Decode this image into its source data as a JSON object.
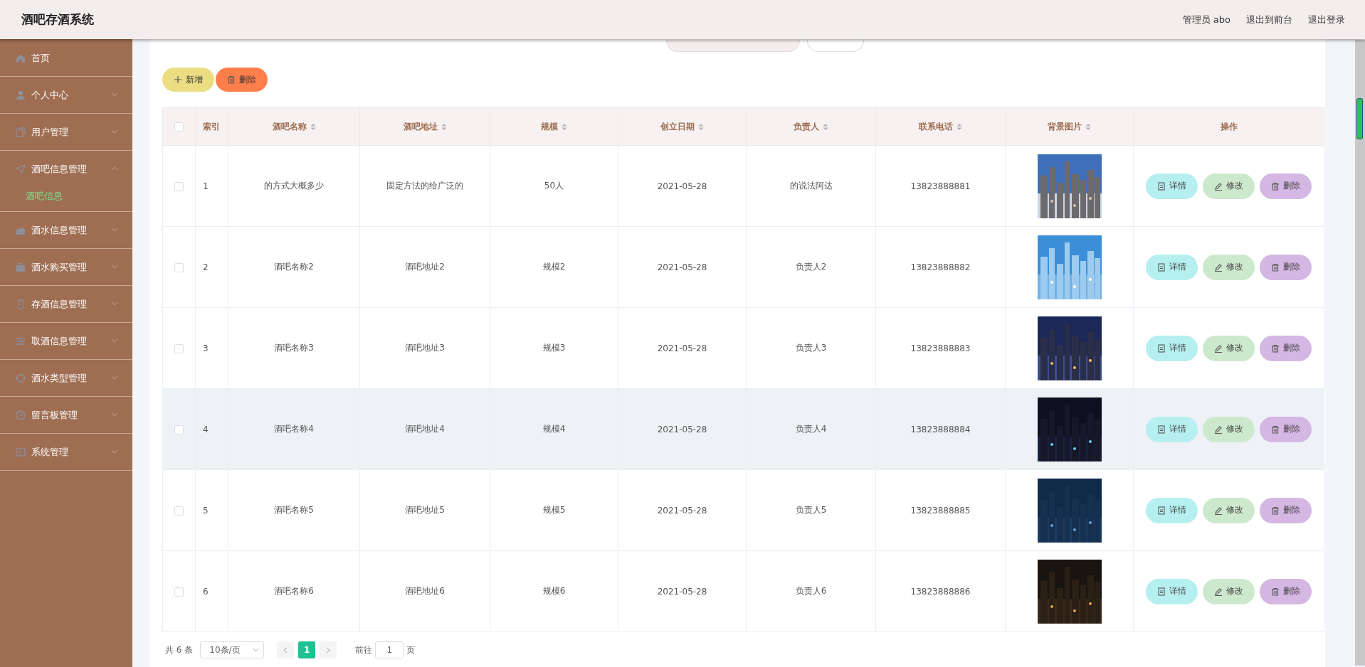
{
  "header": {
    "title": "酒吧存酒系统",
    "user": "管理员 abo",
    "links": [
      "退出到前台",
      "退出登录"
    ]
  },
  "sidebar": {
    "items": [
      {
        "label": "首页",
        "kind": "link"
      },
      {
        "label": "个人中心",
        "kind": "menu",
        "expanded": false
      },
      {
        "label": "用户管理",
        "kind": "menu",
        "expanded": false
      },
      {
        "label": "酒吧信息管理",
        "kind": "menu",
        "expanded": true,
        "children": [
          {
            "label": "酒吧信息",
            "selected": true
          }
        ]
      },
      {
        "label": "酒水信息管理",
        "kind": "menu",
        "expanded": false
      },
      {
        "label": "酒水购买管理",
        "kind": "menu",
        "expanded": false
      },
      {
        "label": "存酒信息管理",
        "kind": "menu",
        "expanded": false
      },
      {
        "label": "取酒信息管理",
        "kind": "menu",
        "expanded": false
      },
      {
        "label": "酒水类型管理",
        "kind": "menu",
        "expanded": false
      },
      {
        "label": "留言板管理",
        "kind": "menu",
        "expanded": false
      },
      {
        "label": "系统管理",
        "kind": "menu",
        "expanded": false
      }
    ]
  },
  "actions": [
    {
      "label": "新增",
      "kind": "add"
    },
    {
      "label": "删除",
      "kind": "delete"
    }
  ],
  "table": {
    "select_all": {
      "checked": false
    },
    "columns": [
      {
        "label": "索引",
        "sortable": false
      },
      {
        "label": "酒吧名称",
        "sortable": true
      },
      {
        "label": "酒吧地址",
        "sortable": true
      },
      {
        "label": "规模",
        "sortable": true
      },
      {
        "label": "创立日期",
        "sortable": true
      },
      {
        "label": "负责人",
        "sortable": true
      },
      {
        "label": "联系电话",
        "sortable": true
      },
      {
        "label": "背景图片",
        "sortable": true
      },
      {
        "label": "操作",
        "sortable": false
      }
    ],
    "rows": [
      {
        "checked": false,
        "highlighted": false,
        "cells": [
          "1",
          "的方式大概多少",
          "固定方法的给广泛的",
          "50人",
          "2021-05-28",
          "的说法阿达",
          "13823888881"
        ],
        "actions": [
          {
            "label": "详情",
            "kind": "detail"
          },
          {
            "label": "修改",
            "kind": "edit"
          },
          {
            "label": "删除",
            "kind": "delete"
          }
        ]
      },
      {
        "checked": false,
        "highlighted": false,
        "cells": [
          "2",
          "酒吧名称2",
          "酒吧地址2",
          "规模2",
          "2021-05-28",
          "负责人2",
          "13823888882"
        ],
        "actions": [
          {
            "label": "详情",
            "kind": "detail"
          },
          {
            "label": "修改",
            "kind": "edit"
          },
          {
            "label": "删除",
            "kind": "delete"
          }
        ]
      },
      {
        "checked": false,
        "highlighted": false,
        "cells": [
          "3",
          "酒吧名称3",
          "酒吧地址3",
          "规模3",
          "2021-05-28",
          "负责人3",
          "13823888883"
        ],
        "actions": [
          {
            "label": "详情",
            "kind": "detail"
          },
          {
            "label": "修改",
            "kind": "edit"
          },
          {
            "label": "删除",
            "kind": "delete"
          }
        ]
      },
      {
        "checked": false,
        "highlighted": true,
        "cells": [
          "4",
          "酒吧名称4",
          "酒吧地址4",
          "规模4",
          "2021-05-28",
          "负责人4",
          "13823888884"
        ],
        "actions": [
          {
            "label": "详情",
            "kind": "detail"
          },
          {
            "label": "修改",
            "kind": "edit"
          },
          {
            "label": "删除",
            "kind": "delete"
          }
        ]
      },
      {
        "checked": false,
        "highlighted": false,
        "cells": [
          "5",
          "酒吧名称5",
          "酒吧地址5",
          "规模5",
          "2021-05-28",
          "负责人5",
          "13823888885"
        ],
        "actions": [
          {
            "label": "详情",
            "kind": "detail"
          },
          {
            "label": "修改",
            "kind": "edit"
          },
          {
            "label": "删除",
            "kind": "delete"
          }
        ]
      },
      {
        "checked": false,
        "highlighted": false,
        "cells": [
          "6",
          "酒吧名称6",
          "酒吧地址6",
          "规模6",
          "2021-05-28",
          "负责人6",
          "13823888886"
        ],
        "actions": [
          {
            "label": "详情",
            "kind": "detail"
          },
          {
            "label": "修改",
            "kind": "edit"
          },
          {
            "label": "删除",
            "kind": "delete"
          }
        ]
      }
    ]
  },
  "pagination": {
    "total": "共 6 条",
    "page_size": "10条/页",
    "pages": [
      {
        "label": "1",
        "selected": true
      }
    ],
    "goto_label": "前往",
    "goto_value": "1",
    "goto_suffix": "页"
  }
}
